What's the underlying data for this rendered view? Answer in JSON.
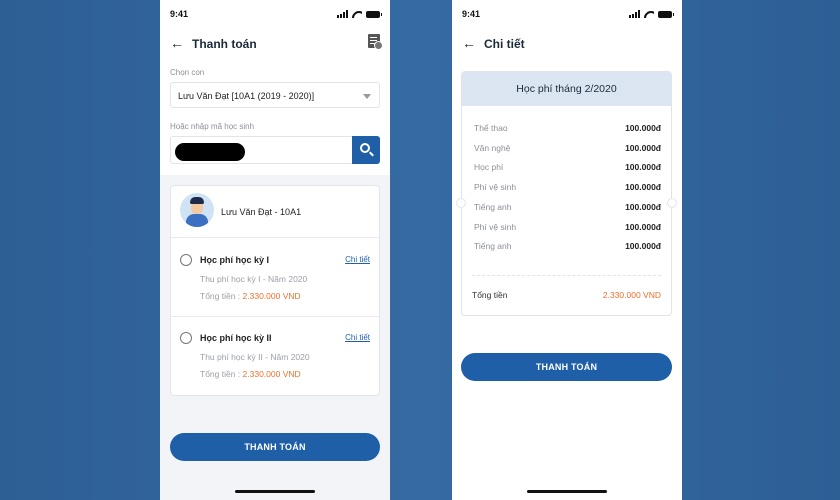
{
  "status": {
    "time": "9:41"
  },
  "screen1": {
    "title": "Thanh toán",
    "child_label": "Chọn con",
    "child_value": "Lưu Văn Đạt [10A1 (2019 - 2020)]",
    "student_code_label": "Hoặc nhập mã học sinh",
    "student_name": "Lưu Văn Đạt - 10A1",
    "fees": [
      {
        "title": "Học phí học kỳ I",
        "detail_link": "Chi tiết",
        "subtitle": "Thu phí học kỳ I - Năm 2020",
        "total_label": "Tổng tiền : ",
        "total_amount": "2.330.000 VND"
      },
      {
        "title": "Học phí học kỳ II",
        "detail_link": "Chi tiết",
        "subtitle": "Thu phí học kỳ II - Năm 2020",
        "total_label": "Tổng tiền : ",
        "total_amount": "2.330.000 VND"
      }
    ],
    "pay_button": "THANH TOÁN"
  },
  "screen2": {
    "title": "Chi tiết",
    "card_title": "Học phí tháng 2/2020",
    "items": [
      {
        "name": "Thể thao",
        "value": "100.000đ"
      },
      {
        "name": "Văn nghệ",
        "value": "100.000đ"
      },
      {
        "name": "Học phí",
        "value": "100.000đ"
      },
      {
        "name": "Phí vệ sinh",
        "value": "100.000đ"
      },
      {
        "name": "Tiếng anh",
        "value": "100.000đ"
      },
      {
        "name": "Phí vệ sinh",
        "value": "100.000đ"
      },
      {
        "name": "Tiếng anh",
        "value": "100.000đ"
      }
    ],
    "total_label": "Tổng tiền",
    "total_value": "2.330.000 VND",
    "pay_button": "THANH TOÁN"
  },
  "colors": {
    "primary": "#1f5fa8",
    "accent_orange": "#f0702a",
    "background": "#2d5f95"
  }
}
